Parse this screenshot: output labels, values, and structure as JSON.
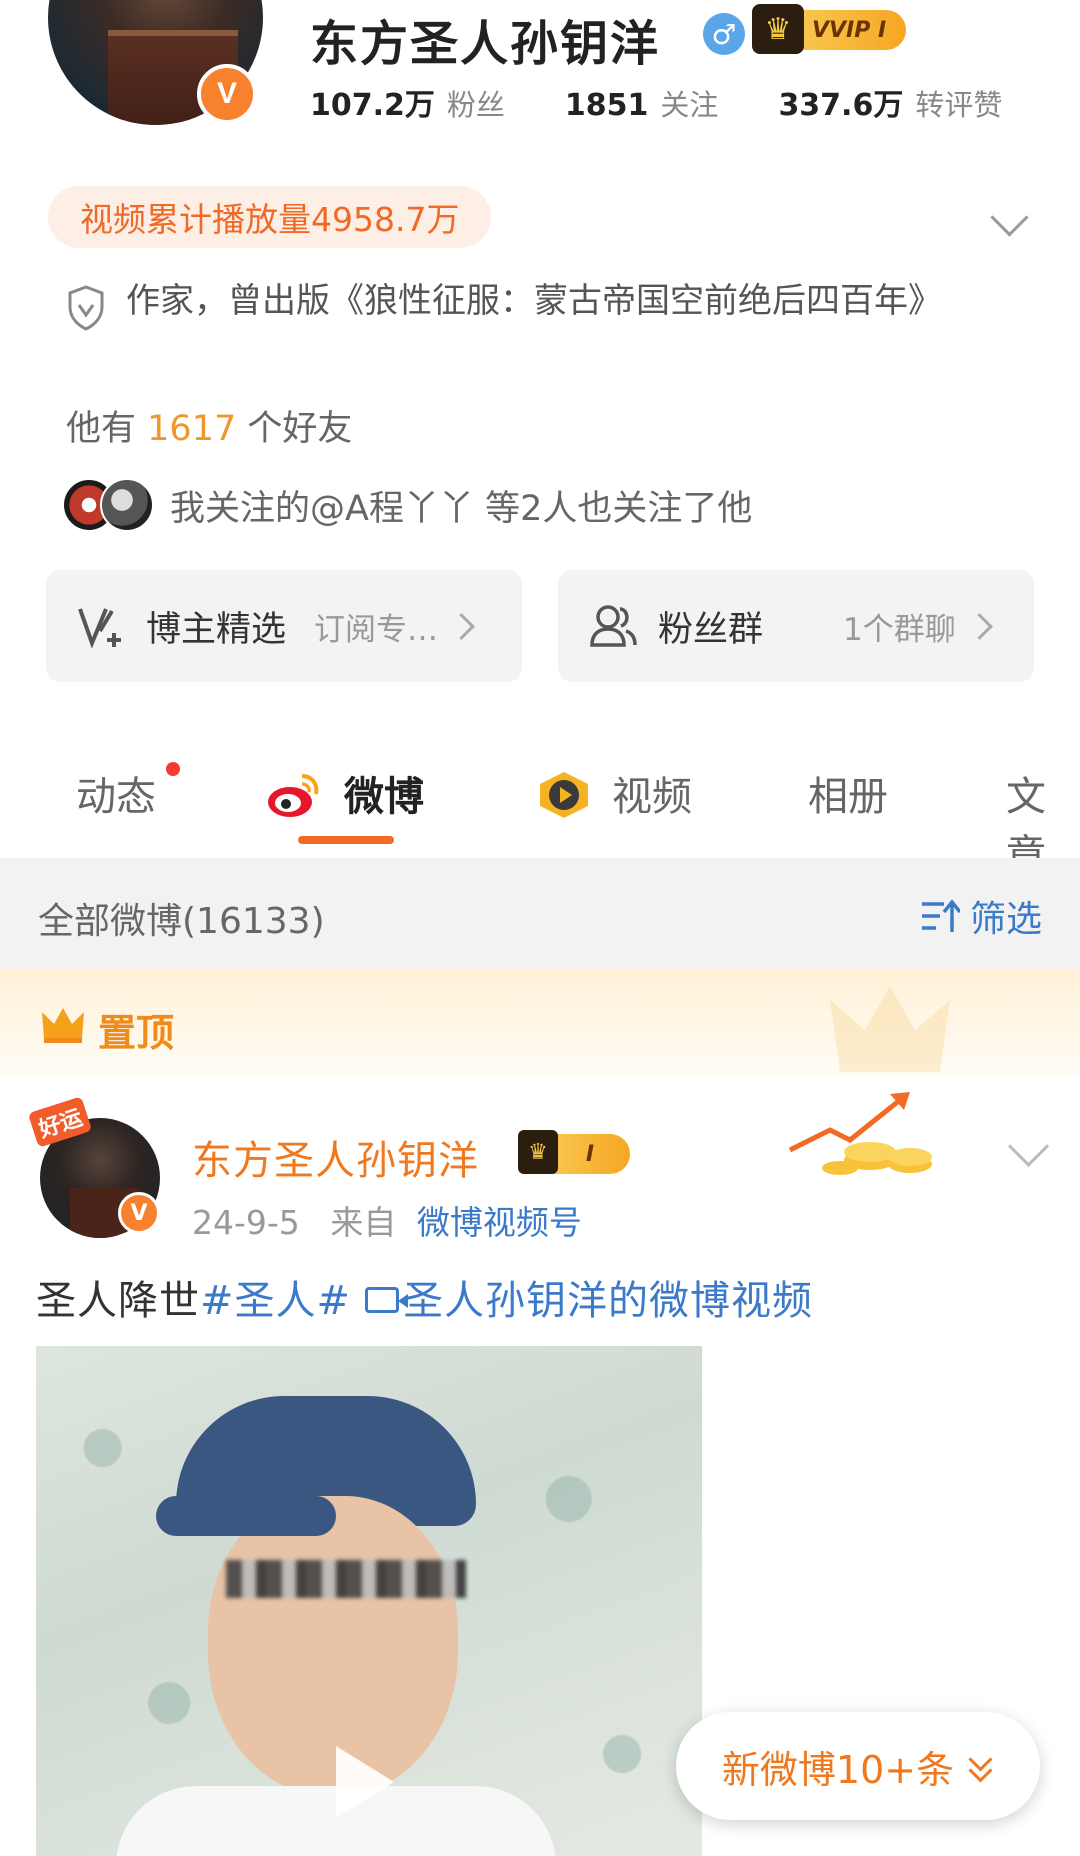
{
  "profile": {
    "username": "东方圣人孙钥洋",
    "gender_icon": "male-icon",
    "vip_label": "VVIP I",
    "verified_mark": "V",
    "stats": [
      {
        "num": "107.2万",
        "label": "粉丝"
      },
      {
        "num": "1851",
        "label": "关注"
      },
      {
        "num": "337.6万",
        "label": "转评赞"
      }
    ],
    "play_count": "视频累计播放量4958.7万",
    "bio": "作家，曾出版《狼性征服：蒙古帝国空前绝后四百年》",
    "friends_prefix": "他有",
    "friends_count": "1617",
    "friends_suffix": "个好友",
    "mutual_text": "我关注的@A程丫丫 等2人也关注了他"
  },
  "cards": {
    "left": {
      "title": "博主精选",
      "sub": "订阅专…"
    },
    "right": {
      "title": "粉丝群",
      "sub": "1个群聊"
    }
  },
  "tabs": [
    {
      "label": "动态"
    },
    {
      "label": "微博"
    },
    {
      "label": "视频"
    },
    {
      "label": "相册"
    },
    {
      "label": "文章"
    }
  ],
  "filter": {
    "count_label": "全部微博(16133)",
    "button_label": "筛选"
  },
  "pinned": {
    "label": "置顶"
  },
  "post": {
    "author": "东方圣人孙钥洋",
    "vip_label": "I",
    "lucky_tag": "好运",
    "date": "24-9-5",
    "from_label": "来自",
    "source": "微博视频号",
    "text_plain": "圣人降世",
    "topic": "#圣人#",
    "video_link": "圣人孙钥洋的微博视频"
  },
  "new_posts": {
    "label": "新微博10+条"
  },
  "colors": {
    "accent": "#f0781e",
    "link": "#3b7ac9",
    "play_chip_bg": "#fdeee6"
  }
}
